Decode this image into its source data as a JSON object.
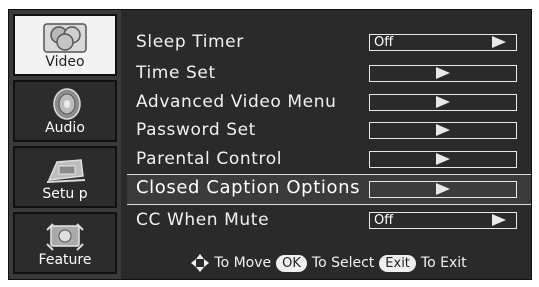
{
  "sidebar": {
    "items": [
      {
        "label": "Video",
        "icon": "video-icon",
        "active": true
      },
      {
        "label": "Audio",
        "icon": "speaker-icon",
        "active": false
      },
      {
        "label": "Setu p",
        "icon": "setup-icon",
        "active": false
      },
      {
        "label": "Feature",
        "icon": "feature-icon",
        "active": false
      }
    ]
  },
  "menu": {
    "items": [
      {
        "label": "Sleep Timer",
        "value": "Off"
      },
      {
        "label": "Time Set",
        "value": ""
      },
      {
        "label": "Advanced Video Menu",
        "value": ""
      },
      {
        "label": "Password Set",
        "value": ""
      },
      {
        "label": "Parental Control",
        "value": ""
      },
      {
        "label": "Closed Caption Options",
        "value": "",
        "selected": true
      },
      {
        "label": "CC When Mute",
        "value": "Off"
      }
    ]
  },
  "footer": {
    "move_text": "To Move",
    "ok_label": "OK",
    "select_text": "To Select",
    "exit_label": "Exit",
    "exit_text": "To Exit"
  },
  "colors": {
    "background": "#2a2a2a",
    "sidebar": "#3a3a3a",
    "active_tile": "#f3f3f3",
    "text": "#f2f2f2"
  }
}
